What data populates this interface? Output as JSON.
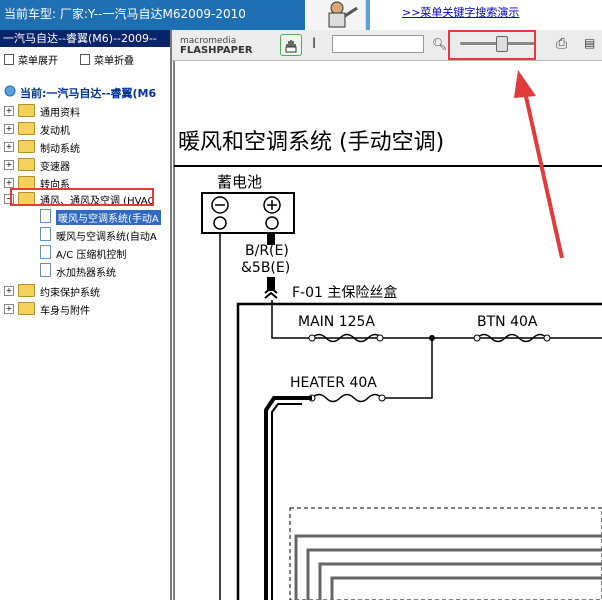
{
  "header": {
    "car_model_text": "当前车型:   厂家:Y--一汽马自达M62009-2010",
    "help_link": ">>菜单关键字搜索演示"
  },
  "sidebar": {
    "title": "一汽马自达--睿翼(M6)--2009--",
    "expand_label": "菜单展开",
    "collapse_label": "菜单折叠",
    "current_label": "当前:一汽马自达--睿翼(M6",
    "items": [
      {
        "label": "通用资料"
      },
      {
        "label": "发动机"
      },
      {
        "label": "制动系统"
      },
      {
        "label": "变速器"
      },
      {
        "label": "转向系"
      },
      {
        "label": "通风、通风及空调 (HVAC"
      }
    ],
    "children": [
      {
        "label": "暖风与空调系统(手动A"
      },
      {
        "label": "暖风与空调系统(自动A"
      },
      {
        "label": "A/C 压缩机控制"
      },
      {
        "label": "水加热器系统"
      }
    ],
    "items_after": [
      {
        "label": "约束保护系统"
      },
      {
        "label": "车身与附件"
      }
    ]
  },
  "viewer": {
    "brand_top": "macromedia",
    "brand_bottom": "FLASHPAPER",
    "zoom_level_fraction": 0.55
  },
  "document": {
    "page_title": "暖风和空调系统 (手动空调)",
    "battery_label": "蓄电池",
    "wire_label_1": "B/R(E)",
    "wire_label_2": "&5B(E)",
    "fuse_box_label": "F-01 主保险丝盒",
    "fuse_main": "MAIN 125A",
    "fuse_btn": "BTN 40A",
    "fuse_heater": "HEATER 40A"
  },
  "colors": {
    "topbar": "#1f6fb3",
    "highlight": "#e23b3b",
    "selection": "#316ac5"
  }
}
